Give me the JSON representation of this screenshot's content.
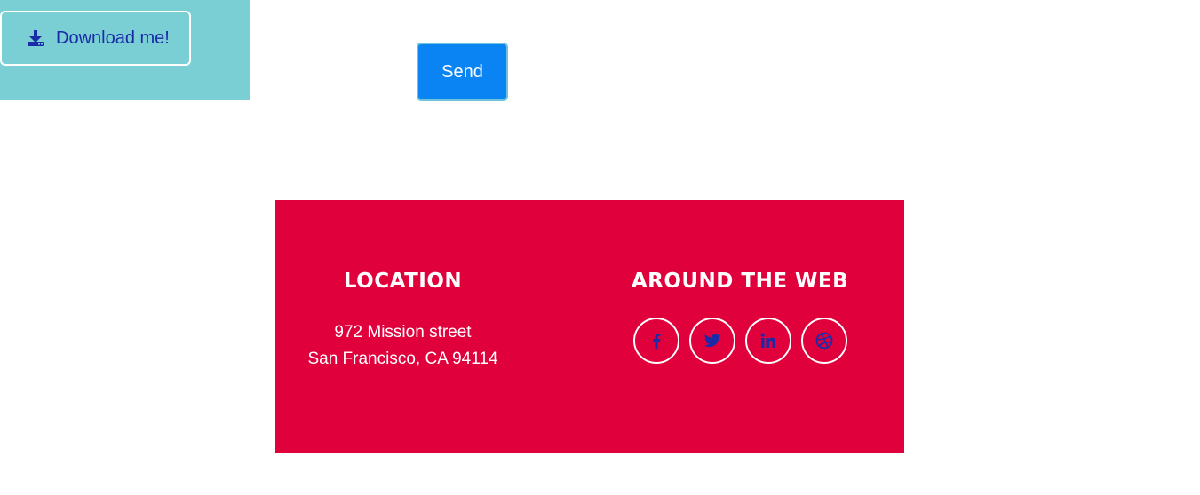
{
  "download": {
    "label": "Download me!",
    "icon": "download-icon"
  },
  "form": {
    "send_label": "Send"
  },
  "footer": {
    "location": {
      "heading": "LOCATION",
      "address_line1": "972 Mission street",
      "address_line2": "San Francisco, CA 94114"
    },
    "web": {
      "heading": "AROUND THE WEB",
      "links": [
        {
          "icon": "facebook-icon"
        },
        {
          "icon": "twitter-icon"
        },
        {
          "icon": "linkedin-icon"
        },
        {
          "icon": "dribbble-icon"
        }
      ]
    }
  },
  "colors": {
    "teal_panel": "#79cfd3",
    "link_blue": "#1a2aa8",
    "send_blue": "#0984f2",
    "footer_red": "#e0003c"
  }
}
